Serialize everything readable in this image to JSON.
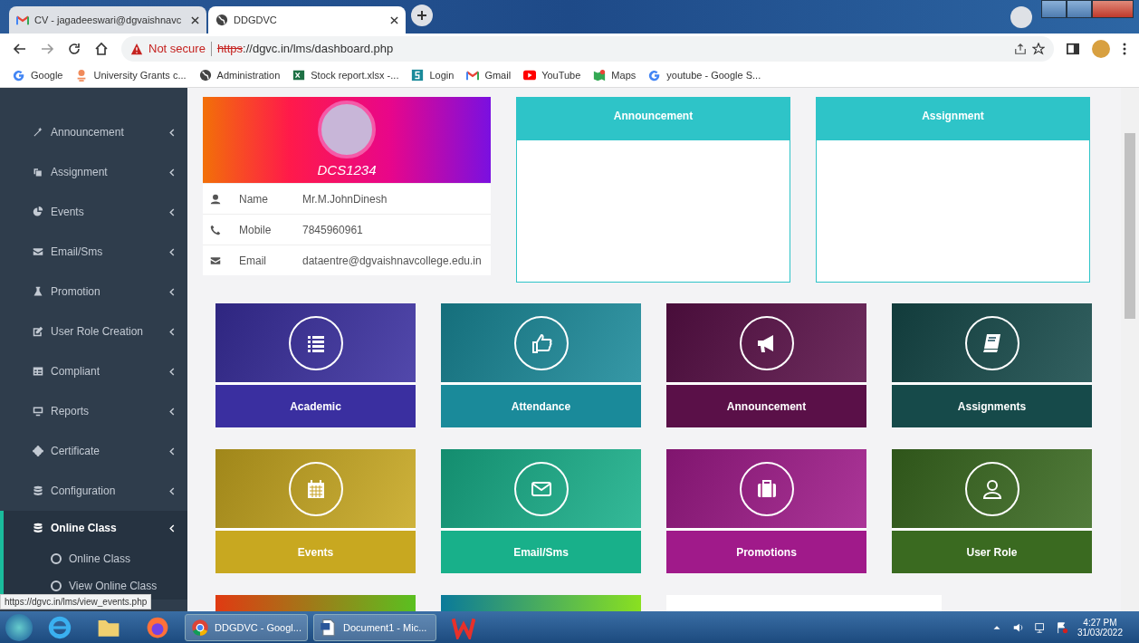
{
  "browser": {
    "tabs": [
      {
        "title": "CV - jagadeeswari@dgvaishnavc",
        "kind": "gmail",
        "selected": false
      },
      {
        "title": "DDGDVC",
        "kind": "globe",
        "selected": true
      }
    ],
    "security": "Not secure",
    "url_scheme": "https",
    "url_rest": "://dgvc.in/lms/dashboard.php",
    "bookmarks": [
      {
        "label": "Google",
        "kind": "google"
      },
      {
        "label": "University Grants c...",
        "kind": "ugc"
      },
      {
        "label": "Administration",
        "kind": "globe"
      },
      {
        "label": "Stock report.xlsx -...",
        "kind": "excel"
      },
      {
        "label": "Login",
        "kind": "login"
      },
      {
        "label": "Gmail",
        "kind": "gmail"
      },
      {
        "label": "YouTube",
        "kind": "youtube"
      },
      {
        "label": "Maps",
        "kind": "maps"
      },
      {
        "label": "youtube - Google S...",
        "kind": "google"
      }
    ]
  },
  "sidebar": {
    "items": [
      {
        "label": "Announcement",
        "kind": "wand",
        "selected": false
      },
      {
        "label": "Assignment",
        "kind": "copy",
        "selected": false
      },
      {
        "label": "Events",
        "kind": "pie",
        "selected": false
      },
      {
        "label": "Email/Sms",
        "kind": "envelope",
        "selected": false
      },
      {
        "label": "Promotion",
        "kind": "flask",
        "selected": false
      },
      {
        "label": "User Role Creation",
        "kind": "edit",
        "selected": false
      },
      {
        "label": "Compliant",
        "kind": "table",
        "selected": false
      },
      {
        "label": "Reports",
        "kind": "monitor",
        "selected": false
      },
      {
        "label": "Certificate",
        "kind": "badge",
        "selected": false
      },
      {
        "label": "Configuration",
        "kind": "database",
        "selected": false
      },
      {
        "label": "Online Class",
        "kind": "database",
        "selected": true,
        "children": [
          {
            "label": "Online Class",
            "selected": false
          },
          {
            "label": "View Online Class",
            "selected": false
          }
        ]
      }
    ]
  },
  "profile": {
    "id": "DCS1234",
    "rows": [
      {
        "kind": "user",
        "label": "Name",
        "value": "Mr.M.JohnDinesh"
      },
      {
        "kind": "phone",
        "label": "Mobile",
        "value": "7845960961"
      },
      {
        "kind": "envelope",
        "label": "Email",
        "value": "dataentre@dgvaishnavcollege.edu.in"
      }
    ]
  },
  "panels": [
    {
      "title": "Announcement"
    },
    {
      "title": "Assignment"
    }
  ],
  "tiles": [
    {
      "label": "Academic",
      "kind": "list",
      "color": "#3a2fa0"
    },
    {
      "label": "Attendance",
      "kind": "thumb",
      "color": "#1a8a9a"
    },
    {
      "label": "Announcement",
      "kind": "megaphone",
      "color": "#5a1048"
    },
    {
      "label": "Assignments",
      "kind": "book",
      "color": "#164a4a"
    },
    {
      "label": "Events",
      "kind": "calendar",
      "color": "#c8a820"
    },
    {
      "label": "Email/Sms",
      "kind": "mail",
      "color": "#18b08a"
    },
    {
      "label": "Promotions",
      "kind": "briefcase",
      "color": "#a01a8a"
    },
    {
      "label": "User Role",
      "kind": "user",
      "color": "#3a6a20"
    }
  ],
  "status_url": "https://dgvc.in/lms/view_events.php",
  "taskbar": {
    "windows": [
      {
        "label": "DDGDVC - Googl...",
        "kind": "chrome"
      },
      {
        "label": "Document1 - Mic...",
        "kind": "word"
      }
    ],
    "time": "4:27 PM",
    "date": "31/03/2022"
  }
}
